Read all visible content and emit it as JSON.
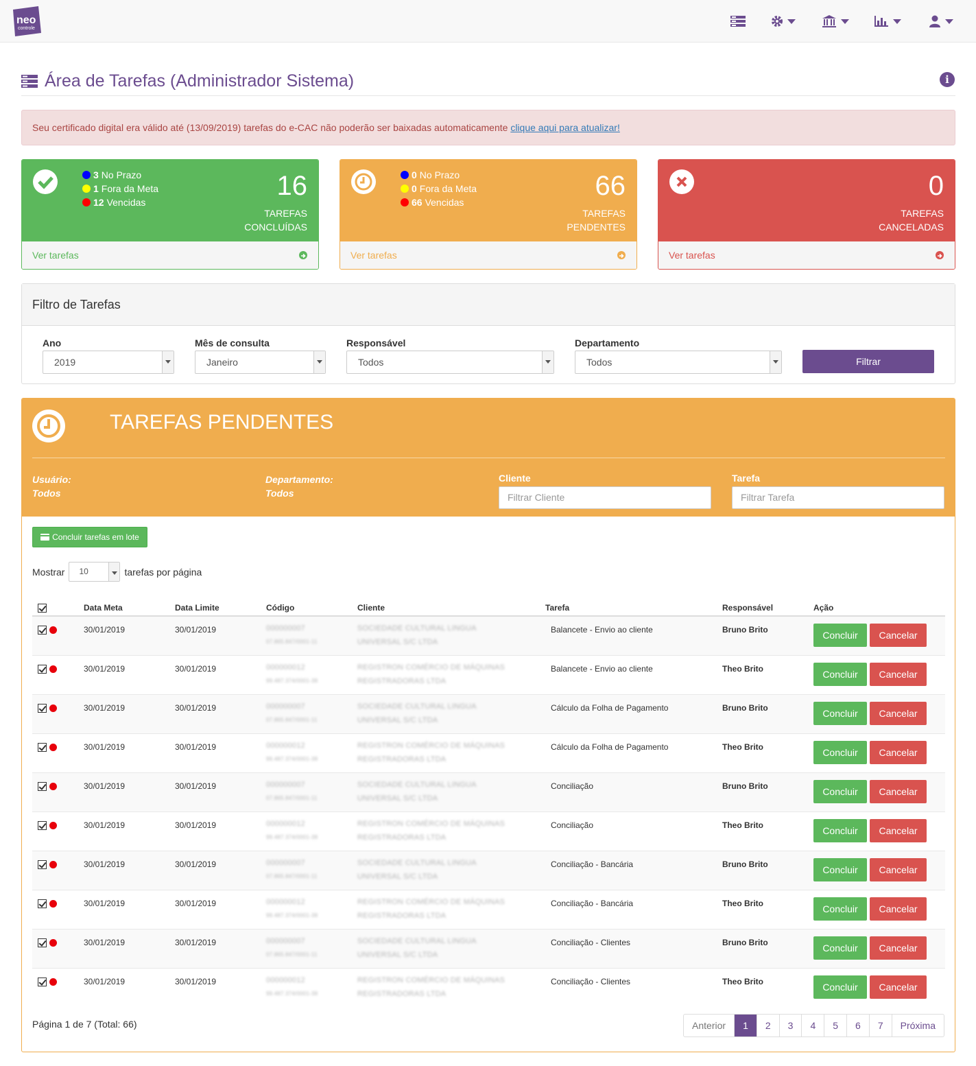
{
  "brand": {
    "logo_top": "neo",
    "logo_bottom": "controle"
  },
  "colors": {
    "purple": "#6b4c8f",
    "green": "#5cb85c",
    "orange": "#f0ad4e",
    "red": "#d9534f"
  },
  "nav": {
    "icons": [
      "tasks-icon",
      "gear-icon",
      "bank-icon",
      "bar-chart-icon",
      "user-icon"
    ]
  },
  "page": {
    "title": "Área de Tarefas (Administrador Sistema)"
  },
  "alert": {
    "text": "Seu certificado digital era válido até (13/09/2019) tarefas do e-CAC não poderão ser baixadas automaticamente ",
    "link": "clique aqui para atualizar!"
  },
  "stats": [
    {
      "count": "16",
      "label1": "TAREFAS",
      "label2": "CONCLUÍDAS",
      "link": "Ver tarefas",
      "prazo": "3",
      "prazo_l": " No Prazo",
      "fora": "1",
      "fora_l": " Fora da Meta",
      "venc": "12",
      "venc_l": " Vencidas"
    },
    {
      "count": "66",
      "label1": "TAREFAS",
      "label2": "PENDENTES",
      "link": "Ver tarefas",
      "prazo": "0",
      "prazo_l": " No Prazo",
      "fora": "0",
      "fora_l": " Fora da Meta",
      "venc": "66",
      "venc_l": " Vencidas"
    },
    {
      "count": "0",
      "label1": "TAREFAS",
      "label2": "CANCELADAS",
      "link": "Ver tarefas"
    }
  ],
  "filter": {
    "title": "Filtro de Tarefas",
    "ano_label": "Ano",
    "ano": "2019",
    "mes_label": "Mês de consulta",
    "mes": "Janeiro",
    "resp_label": "Responsável",
    "resp": "Todos",
    "dep_label": "Departamento",
    "dep": "Todos",
    "button": "Filtrar"
  },
  "pending": {
    "title": "TAREFAS PENDENTES",
    "usuario_label": "Usuário:",
    "usuario": "Todos",
    "dep_label": "Departamento:",
    "dep": "Todos",
    "cliente_label": "Cliente",
    "cliente_ph": "Filtrar Cliente",
    "tarefa_label": "Tarefa",
    "tarefa_ph": "Filtrar Tarefa",
    "batch_button": "Concluir tarefas em lote",
    "show_prefix": "Mostrar",
    "show_value": "10",
    "show_suffix": "tarefas por página"
  },
  "table": {
    "headers": [
      "Data Meta",
      "Data Limite",
      "Código",
      "Cliente",
      "Tarefa",
      "Responsável",
      "Ação"
    ],
    "rows": [
      {
        "meta": "30/01/2019",
        "limite": "30/01/2019",
        "cod1": "000000007",
        "cod2": "07.865.847/0001-11",
        "cli1": "SOCIEDADE CULTURAL LINGUA",
        "cli2": "UNIVERSAL S/C LTDA",
        "tarefa": "Balancete - Envio ao cliente",
        "resp": "Bruno Brito"
      },
      {
        "meta": "30/01/2019",
        "limite": "30/01/2019",
        "cod1": "000000012",
        "cod2": "99.487.374/0001-38",
        "cli1": "REGISTRON COMÉRCIO DE MÁQUINAS",
        "cli2": "REGISTRADORAS LTDA",
        "tarefa": "Balancete - Envio ao cliente",
        "resp": "Theo Brito"
      },
      {
        "meta": "30/01/2019",
        "limite": "30/01/2019",
        "cod1": "000000007",
        "cod2": "07.865.847/0001-11",
        "cli1": "SOCIEDADE CULTURAL LINGUA",
        "cli2": "UNIVERSAL S/C LTDA",
        "tarefa": "Cálculo da Folha de Pagamento",
        "resp": "Bruno Brito"
      },
      {
        "meta": "30/01/2019",
        "limite": "30/01/2019",
        "cod1": "000000012",
        "cod2": "99.487.374/0001-38",
        "cli1": "REGISTRON COMÉRCIO DE MÁQUINAS",
        "cli2": "REGISTRADORAS LTDA",
        "tarefa": "Cálculo da Folha de Pagamento",
        "resp": "Theo Brito"
      },
      {
        "meta": "30/01/2019",
        "limite": "30/01/2019",
        "cod1": "000000007",
        "cod2": "07.865.847/0001-11",
        "cli1": "SOCIEDADE CULTURAL LINGUA",
        "cli2": "UNIVERSAL S/C LTDA",
        "tarefa": "Conciliação",
        "resp": "Bruno Brito"
      },
      {
        "meta": "30/01/2019",
        "limite": "30/01/2019",
        "cod1": "000000012",
        "cod2": "99.487.374/0001-38",
        "cli1": "REGISTRON COMÉRCIO DE MÁQUINAS",
        "cli2": "REGISTRADORAS LTDA",
        "tarefa": "Conciliação",
        "resp": "Theo Brito"
      },
      {
        "meta": "30/01/2019",
        "limite": "30/01/2019",
        "cod1": "000000007",
        "cod2": "07.865.847/0001-11",
        "cli1": "SOCIEDADE CULTURAL LINGUA",
        "cli2": "UNIVERSAL S/C LTDA",
        "tarefa": "Conciliação - Bancária",
        "resp": "Bruno Brito"
      },
      {
        "meta": "30/01/2019",
        "limite": "30/01/2019",
        "cod1": "000000012",
        "cod2": "99.487.374/0001-38",
        "cli1": "REGISTRON COMÉRCIO DE MÁQUINAS",
        "cli2": "REGISTRADORAS LTDA",
        "tarefa": "Conciliação - Bancária",
        "resp": "Theo Brito"
      },
      {
        "meta": "30/01/2019",
        "limite": "30/01/2019",
        "cod1": "000000007",
        "cod2": "07.865.847/0001-11",
        "cli1": "SOCIEDADE CULTURAL LINGUA",
        "cli2": "UNIVERSAL S/C LTDA",
        "tarefa": "Conciliação - Clientes",
        "resp": "Bruno Brito"
      },
      {
        "meta": "30/01/2019",
        "limite": "30/01/2019",
        "cod1": "000000012",
        "cod2": "99.487.374/0001-38",
        "cli1": "REGISTRON COMÉRCIO DE MÁQUINAS",
        "cli2": "REGISTRADORAS LTDA",
        "tarefa": "Conciliação - Clientes",
        "resp": "Theo Brito"
      }
    ],
    "btn_ok": "Concluir",
    "btn_cancel": "Cancelar"
  },
  "pagination": {
    "info": "Página 1 de 7 (Total: 66)",
    "prev": "Anterior",
    "pages": [
      "1",
      "2",
      "3",
      "4",
      "5",
      "6",
      "7"
    ],
    "next": "Próxima",
    "active": "1"
  }
}
